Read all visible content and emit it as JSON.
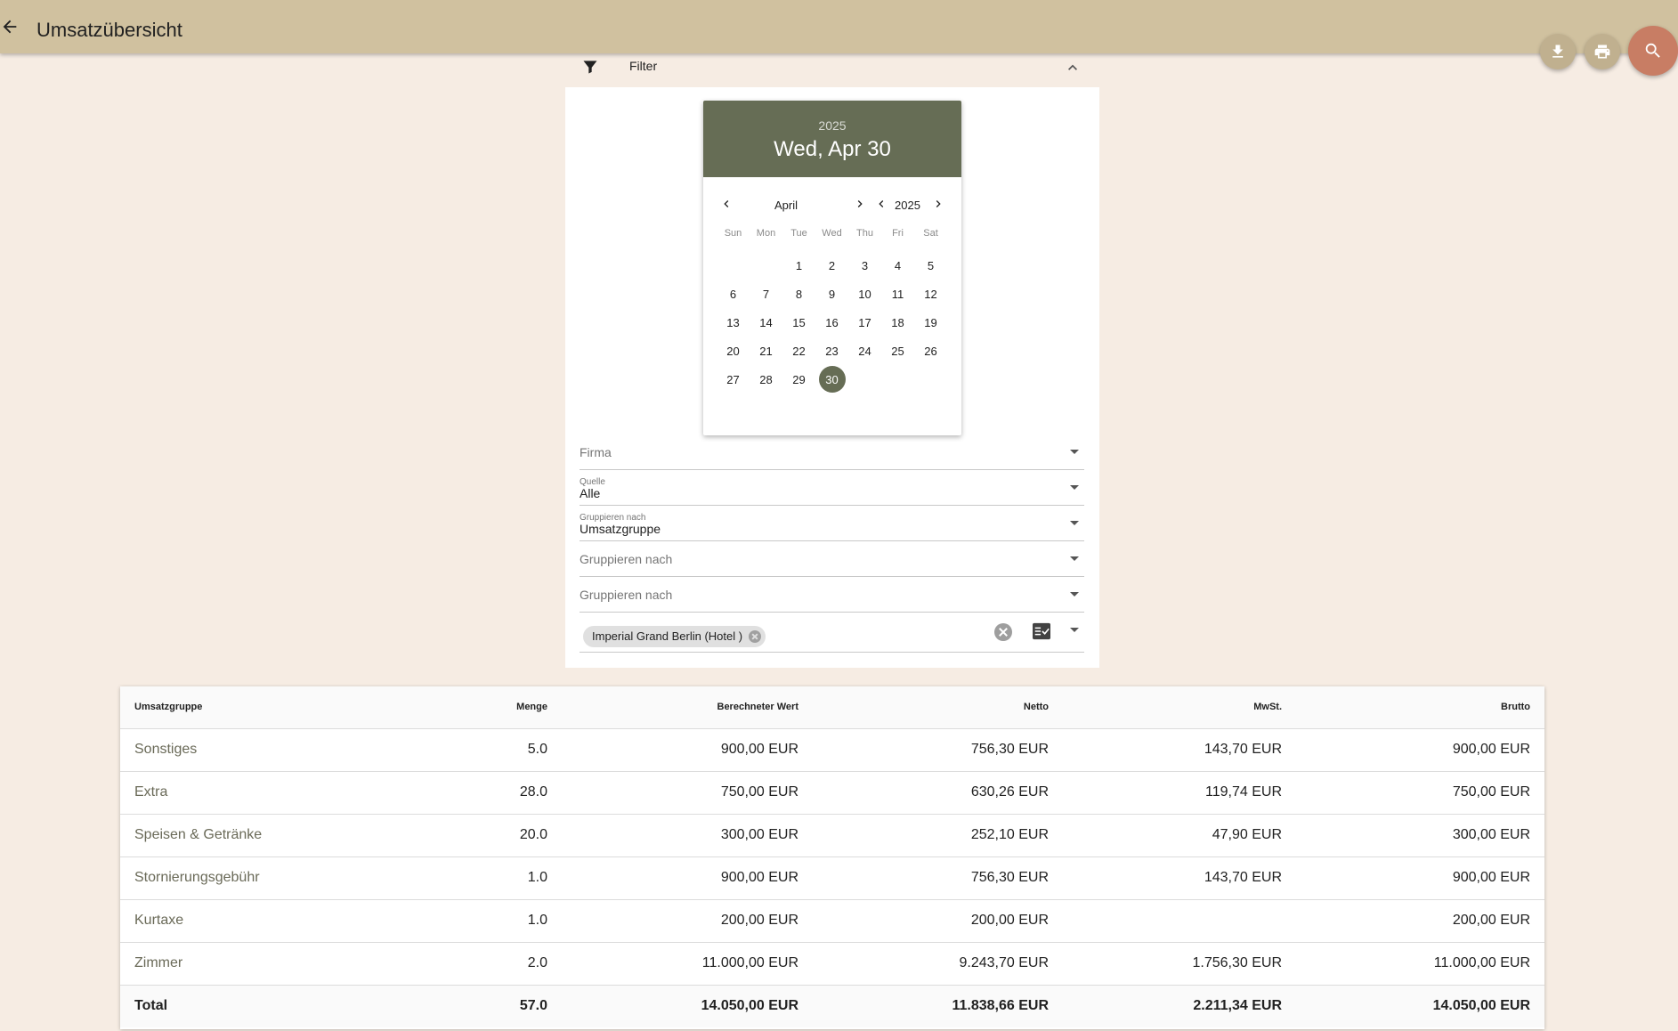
{
  "app_bar": {
    "title": "Umsatzübersicht"
  },
  "filter": {
    "label": "Filter"
  },
  "datepicker": {
    "header_year": "2025",
    "header_date": "Wed, Apr 30",
    "month": "April",
    "year": "2025",
    "weekdays": [
      "Sun",
      "Mon",
      "Tue",
      "Wed",
      "Thu",
      "Fri",
      "Sat"
    ],
    "leading_blanks": 2,
    "days_in_month": 30,
    "selected_day": 30
  },
  "fields": {
    "firma": {
      "placeholder": "Firma"
    },
    "quelle": {
      "label": "Quelle",
      "value": "Alle"
    },
    "gruppieren1": {
      "label": "Gruppieren nach",
      "value": "Umsatzgruppe"
    },
    "gruppieren2": {
      "placeholder": "Gruppieren nach"
    },
    "gruppieren3": {
      "placeholder": "Gruppieren nach"
    },
    "hotel": {
      "chip": "Imperial Grand Berlin (Hotel )"
    }
  },
  "table": {
    "headers": [
      "Umsatzgruppe",
      "Menge",
      "Berechneter Wert",
      "Netto",
      "MwSt.",
      "Brutto"
    ],
    "rows": [
      [
        "Sonstiges",
        "5.0",
        "900,00 EUR",
        "756,30 EUR",
        "143,70 EUR",
        "900,00 EUR"
      ],
      [
        "Extra",
        "28.0",
        "750,00 EUR",
        "630,26 EUR",
        "119,74 EUR",
        "750,00 EUR"
      ],
      [
        "Speisen & Getränke",
        "20.0",
        "300,00 EUR",
        "252,10 EUR",
        "47,90 EUR",
        "300,00 EUR"
      ],
      [
        "Stornierungsgebühr",
        "1.0",
        "900,00 EUR",
        "756,30 EUR",
        "143,70 EUR",
        "900,00 EUR"
      ],
      [
        "Kurtaxe",
        "1.0",
        "200,00 EUR",
        "200,00 EUR",
        "",
        "200,00 EUR"
      ],
      [
        "Zimmer",
        "2.0",
        "11.000,00 EUR",
        "9.243,70 EUR",
        "1.756,30 EUR",
        "11.000,00 EUR"
      ]
    ],
    "total": [
      "Total",
      "57.0",
      "14.050,00 EUR",
      "11.838,66 EUR",
      "2.211,34 EUR",
      "14.050,00 EUR"
    ]
  },
  "colors": {
    "app_bar": "#d0c19f",
    "background": "#f6ece3",
    "datepicker_header": "#666d55",
    "search_fab": "#c87d64",
    "small_fab": "#c0b08f"
  }
}
